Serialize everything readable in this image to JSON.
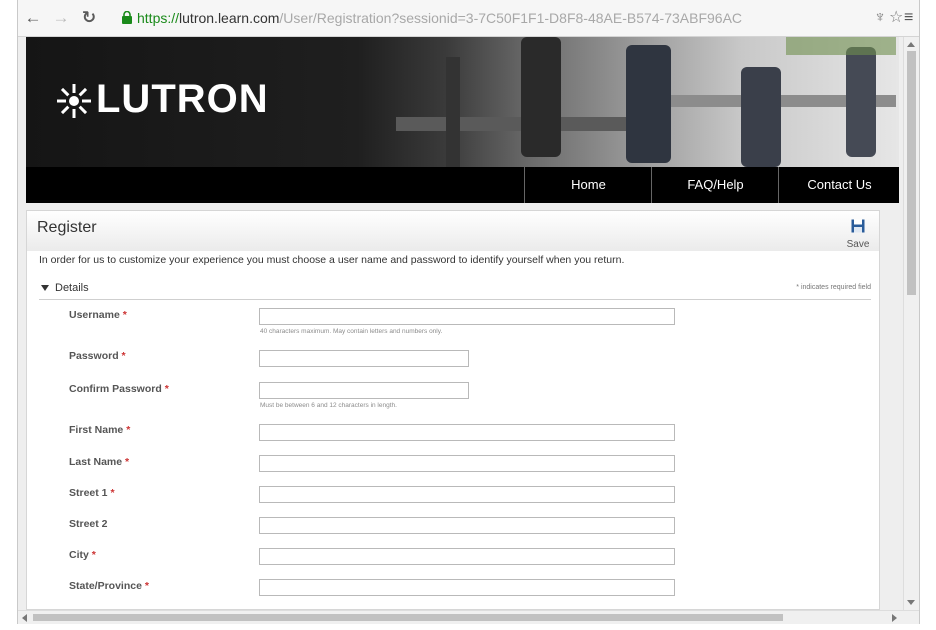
{
  "browser": {
    "url_scheme": "https://",
    "url_host": "lutron.learn.com",
    "url_path": "/User/Registration?sessionid=3-7C50F1F1-D8F8-48AE-B574-73ABF96AC",
    "back_icon": "back-arrow-icon",
    "forward_icon": "forward-arrow-icon",
    "reload_icon": "reload-icon",
    "lock_icon": "lock-icon",
    "extension_icon": "extension-icon",
    "star_icon": "bookmark-star-icon",
    "menu_icon": "hamburger-menu-icon"
  },
  "site": {
    "logo_text": "LUTRON",
    "nav": [
      {
        "label": "Home"
      },
      {
        "label": "FAQ/Help"
      },
      {
        "label": "Contact Us"
      }
    ]
  },
  "page": {
    "title": "Register",
    "save_label": "Save",
    "intro": "In order for us to customize your experience you must choose a user name and password to identify yourself when you return.",
    "section_title": "Details",
    "required_note": "* indicates required field",
    "required_mark": "*"
  },
  "form": {
    "fields": [
      {
        "label": "Username",
        "required": true,
        "value": "",
        "hint": "40 characters maximum. May contain letters and numbers only."
      },
      {
        "label": "Password",
        "required": true,
        "value": ""
      },
      {
        "label": "Confirm Password",
        "required": true,
        "value": "",
        "hint": "Must be between 6 and 12 characters in length."
      },
      {
        "label": "First Name",
        "required": true,
        "value": ""
      },
      {
        "label": "Last Name",
        "required": true,
        "value": ""
      },
      {
        "label": "Street 1",
        "required": true,
        "value": ""
      },
      {
        "label": "Street 2",
        "required": false,
        "value": ""
      },
      {
        "label": "City",
        "required": true,
        "value": ""
      },
      {
        "label": "State/Province",
        "required": true,
        "value": ""
      }
    ]
  },
  "colors": {
    "nav_bg": "#000000",
    "secure_green": "#1a8a1a",
    "required_red": "#cc3333",
    "save_icon_blue": "#2a5c9a"
  }
}
